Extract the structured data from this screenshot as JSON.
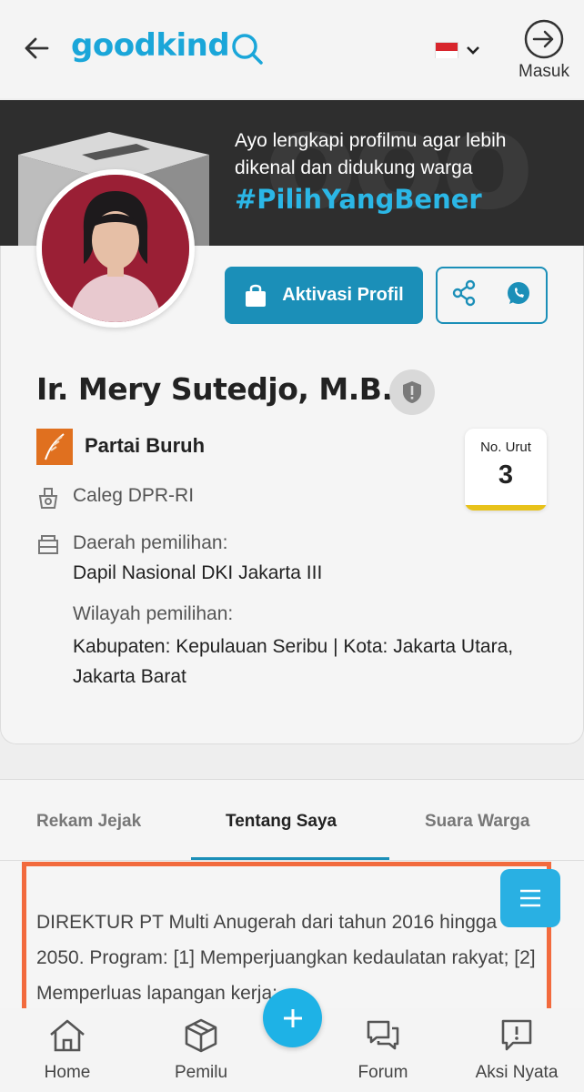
{
  "header": {
    "logo_text": "goodkind",
    "login_label": "Masuk",
    "flag": "indonesia-flag"
  },
  "banner": {
    "line1": "Ayo lengkapi profilmu agar lebih",
    "line2": "dikenal dan didukung warga",
    "hashtag": "#PilihYangBener"
  },
  "profile": {
    "activate_label": "Aktivasi Profil",
    "name": "Ir. Mery Sutedjo, M.B.A.",
    "party": "Partai Buruh",
    "no_urut_label": "No. Urut",
    "no_urut_value": "3",
    "caleg": "Caleg DPR-RI",
    "dapil_label": "Daerah pemilihan:",
    "dapil_value": "Dapil Nasional DKI Jakarta III",
    "wilayah_label": "Wilayah pemilihan:",
    "wilayah_value": "Kabupaten: Kepulauan Seribu | Kota: Jakarta Utara, Jakarta Barat"
  },
  "tabs": [
    {
      "label": "Rekam Jejak"
    },
    {
      "label": "Tentang Saya"
    },
    {
      "label": "Suara Warga"
    }
  ],
  "about": {
    "text": "DIREKTUR PT Multi Anugerah dari tahun 2016 hingga 2050. Program: [1] Memperjuangkan kedaulatan rakyat; [2] Memperluas lapangan kerja;"
  },
  "bottom_nav": [
    {
      "label": "Home",
      "icon": "home-icon"
    },
    {
      "label": "Pemilu",
      "icon": "box-icon"
    },
    {
      "label": "Forum",
      "icon": "chat-icon"
    },
    {
      "label": "Aksi Nyata",
      "icon": "alert-bubble-icon"
    }
  ],
  "colors": {
    "brand": "#1aa6d9",
    "primary_button": "#1b8fb8",
    "highlight": "#f26a3d",
    "no_urut_bar": "#e8c21a"
  }
}
